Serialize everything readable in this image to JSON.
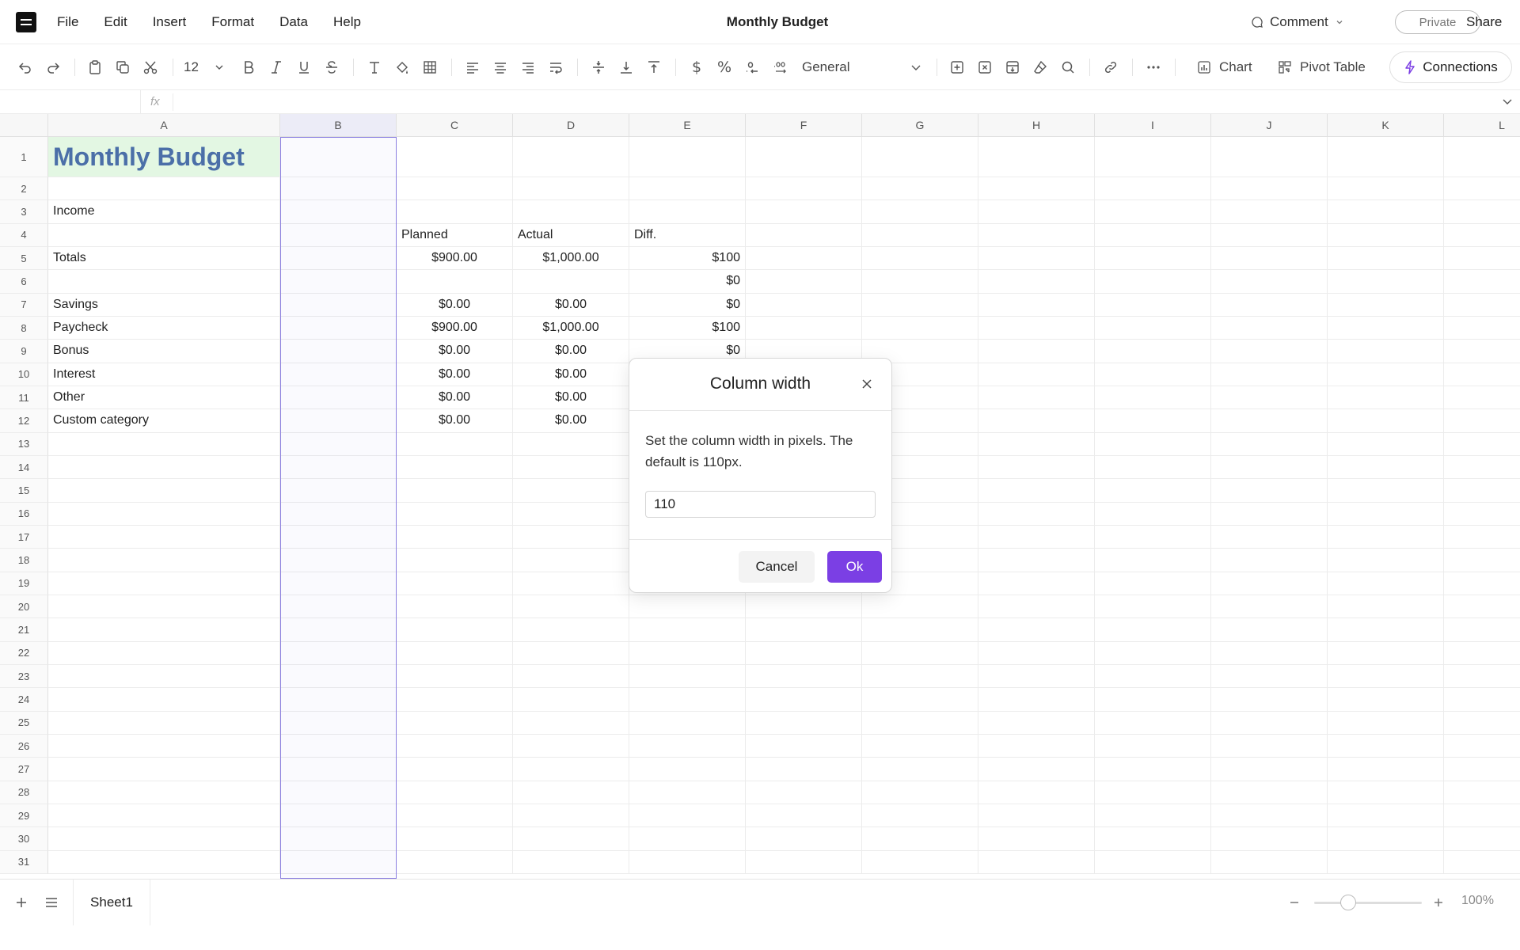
{
  "menubar": {
    "logo_icon": "app-menu-icon",
    "items": [
      "File",
      "Edit",
      "Insert",
      "Format",
      "Data",
      "Help"
    ],
    "title": "Monthly Budget",
    "comment_label": "Comment",
    "private_label": "Private",
    "share_label": "Share"
  },
  "toolbar": {
    "font_size": "12",
    "number_format": "General",
    "chart_label": "Chart",
    "pivot_label": "Pivot Table",
    "connections_label": "Connections",
    "accent_color": "#7b3fe4"
  },
  "formula_bar": {
    "fx_label": "fx",
    "value": ""
  },
  "grid": {
    "columns": [
      "A",
      "B",
      "C",
      "D",
      "E",
      "F",
      "G",
      "H",
      "I",
      "J",
      "K",
      "L"
    ],
    "selected_column": "B",
    "rows": [
      "1",
      "2",
      "3",
      "4",
      "5",
      "6",
      "7",
      "8",
      "9",
      "10",
      "11",
      "12",
      "13",
      "14",
      "15",
      "16",
      "17",
      "18",
      "19",
      "20",
      "21",
      "22",
      "23",
      "24",
      "25",
      "26",
      "27",
      "28",
      "29",
      "30",
      "31"
    ],
    "title_fill_color": "#e3f7e3",
    "title_text_color": "#4b6fa8",
    "cells": {
      "A1": "Monthly Budget",
      "A3": "Income",
      "C4": "Planned",
      "D4": "Actual",
      "E4": "Diff.",
      "A5": "Totals",
      "C5": "$900.00",
      "D5": "$1,000.00",
      "E5": "$100",
      "E6": "$0",
      "A7": "Savings",
      "C7": "$0.00",
      "D7": "$0.00",
      "E7": "$0",
      "A8": "Paycheck",
      "C8": "$900.00",
      "D8": "$1,000.00",
      "E8": "$100",
      "A9": "Bonus",
      "C9": "$0.00",
      "D9": "$0.00",
      "E9": "$0",
      "A10": "Interest",
      "C10": "$0.00",
      "D10": "$0.00",
      "A11": "Other",
      "C11": "$0.00",
      "D11": "$0.00",
      "A12": "Custom category",
      "C12": "$0.00",
      "D12": "$0.00"
    }
  },
  "bottombar": {
    "sheet_name": "Sheet1",
    "zoom": "100%",
    "zoom_level_percent": 100
  },
  "dialog": {
    "title": "Column width",
    "description": "Set the column width in pixels. The default is 110px.",
    "input_value": "110",
    "cancel_label": "Cancel",
    "ok_label": "Ok"
  }
}
